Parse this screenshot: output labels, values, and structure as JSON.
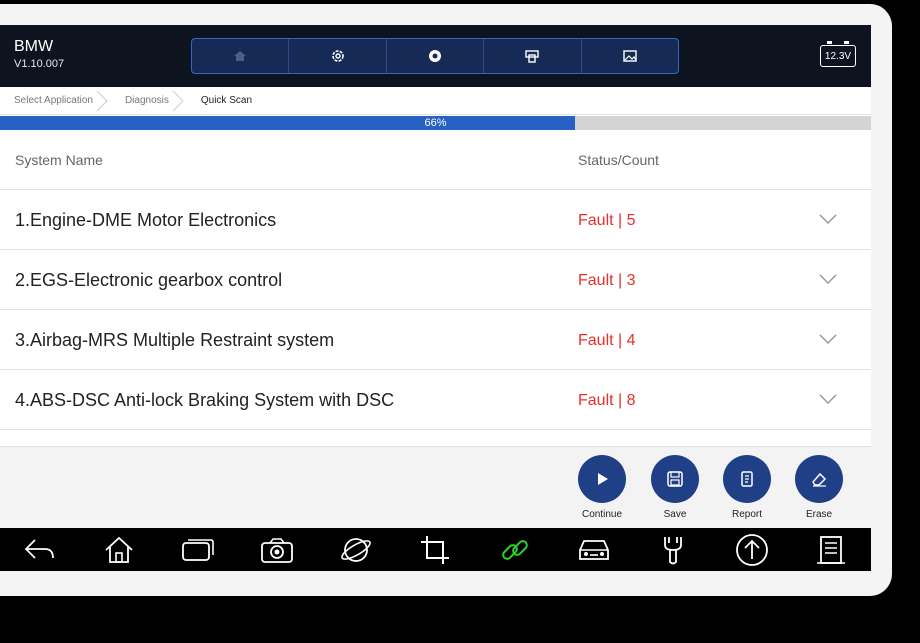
{
  "app": {
    "name": "BMW",
    "version": "V1.10.007"
  },
  "toolbar": {
    "icons": [
      "home-icon",
      "settings-icon",
      "record-icon",
      "print-icon",
      "image-icon"
    ]
  },
  "battery": {
    "voltage": "12.3V"
  },
  "breadcrumb": [
    "Select Application",
    "Diagnosis",
    "Quick Scan"
  ],
  "progress": {
    "percent": 66,
    "label": "66%"
  },
  "table": {
    "headers": {
      "system": "System Name",
      "status": "Status/Count"
    },
    "rows": [
      {
        "system": "1.Engine-DME Motor Electronics",
        "status": "Fault | 5"
      },
      {
        "system": "2.EGS-Electronic gearbox control",
        "status": "Fault | 3"
      },
      {
        "system": "3.Airbag-MRS Multiple Restraint system",
        "status": "Fault | 4"
      },
      {
        "system": "4.ABS-DSC Anti-lock Braking System with DSC",
        "status": "Fault | 8"
      }
    ]
  },
  "actions": {
    "continue": "Continue",
    "save": "Save",
    "report": "Report",
    "erase": "Erase"
  },
  "navbar": {
    "icons": [
      "back-icon",
      "home-icon",
      "recent-apps-icon",
      "camera-icon",
      "browser-icon",
      "crop-icon",
      "link-icon",
      "car-icon",
      "wrench-icon",
      "upload-icon",
      "document-icon"
    ]
  },
  "colors": {
    "header_bg": "#0d1420",
    "accent_blue": "#2761c4",
    "fault_red": "#e8302a",
    "action_button": "#1f3f86",
    "link_green": "#2fd12f"
  }
}
